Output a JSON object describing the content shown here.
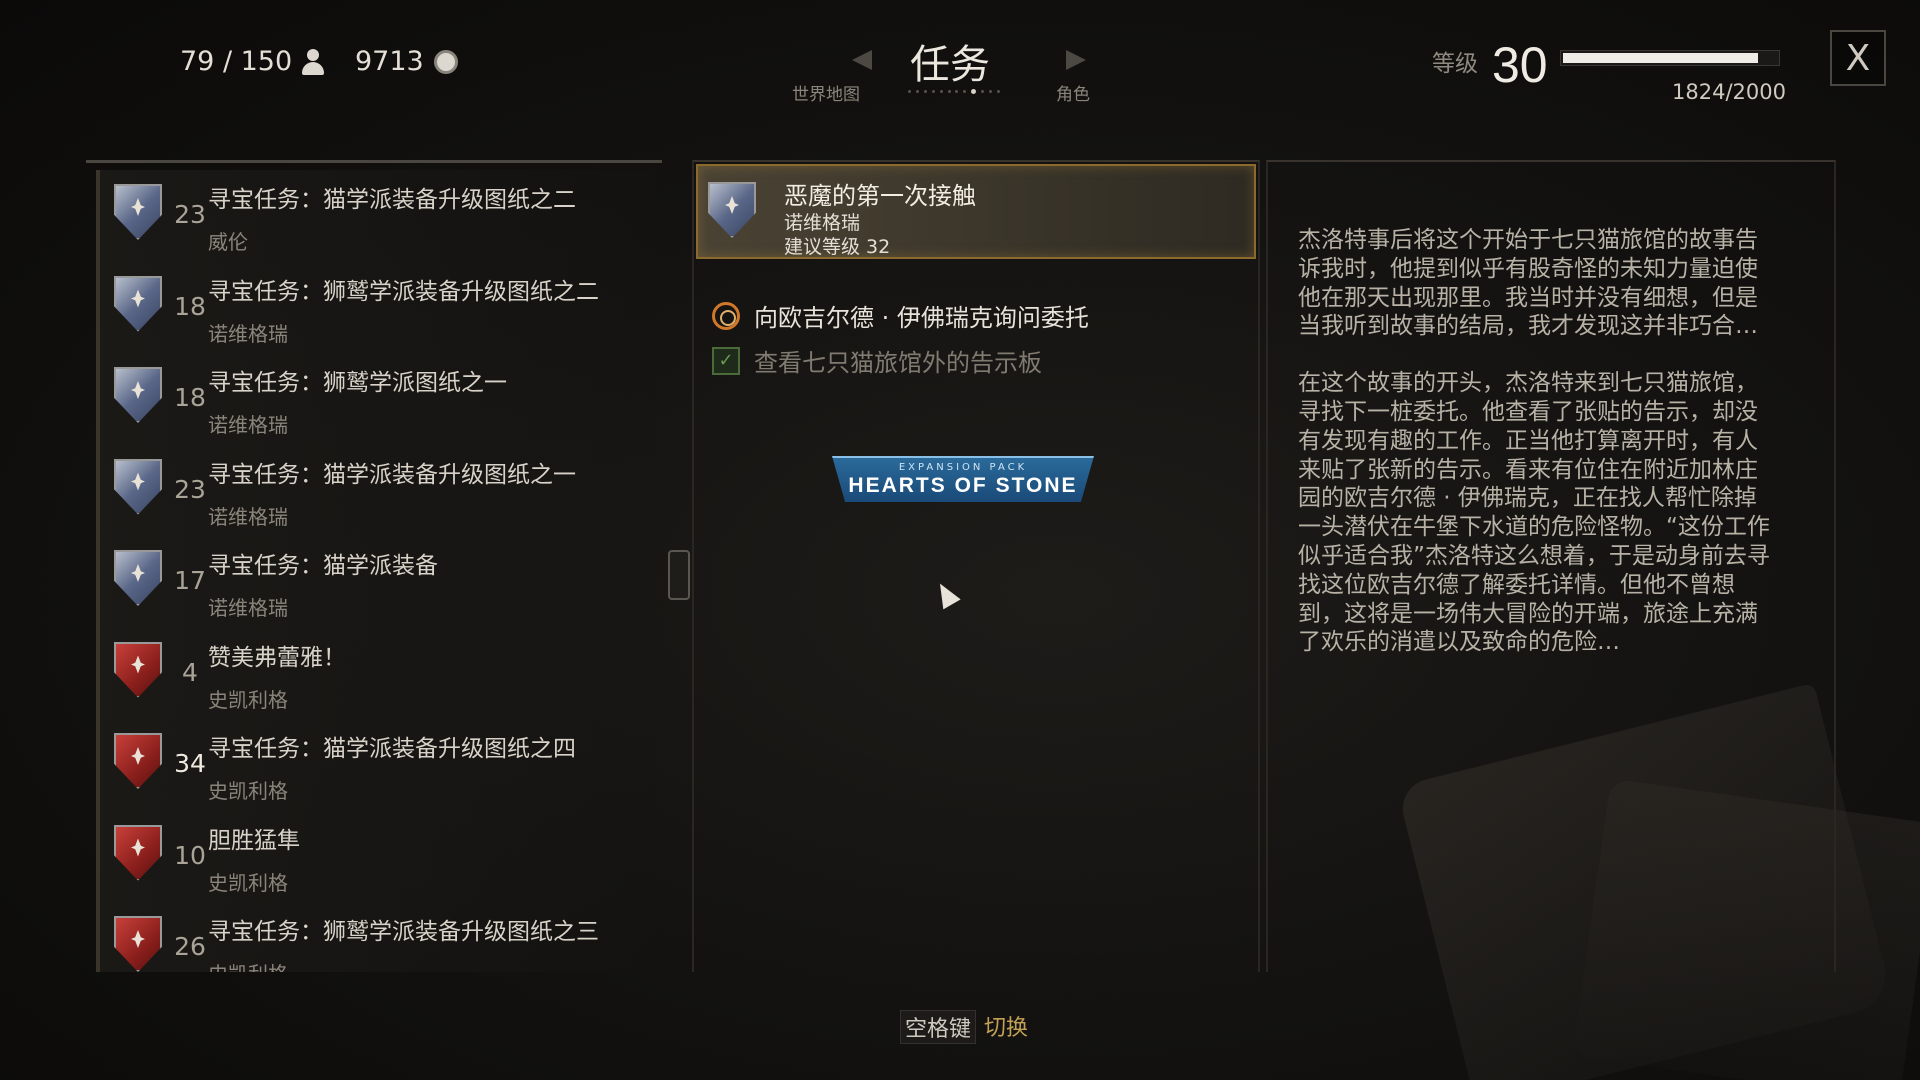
{
  "header": {
    "weight": "79 / 150",
    "money": "9713",
    "title": "任务",
    "nav_left": "世界地图",
    "nav_right": "角色",
    "level_label": "等级",
    "level": "30",
    "xp": "1824/2000",
    "xp_fraction": 0.912,
    "close_label": "X"
  },
  "quest_list": [
    {
      "title": "寻宝任务：猫学派装备升级图纸之二",
      "region": "威伦",
      "level": "23",
      "shield": "blue"
    },
    {
      "title": "寻宝任务：狮鹫学派装备升级图纸之二",
      "region": "诺维格瑞",
      "level": "18",
      "shield": "blue"
    },
    {
      "title": "寻宝任务：狮鹫学派图纸之一",
      "region": "诺维格瑞",
      "level": "18",
      "shield": "blue"
    },
    {
      "title": "寻宝任务：猫学派装备升级图纸之一",
      "region": "诺维格瑞",
      "level": "23",
      "shield": "blue"
    },
    {
      "title": "寻宝任务：猫学派装备",
      "region": "诺维格瑞",
      "level": "17",
      "shield": "blue"
    },
    {
      "title": "赞美弗蕾雅！",
      "region": "史凯利格",
      "level": "4",
      "shield": "red"
    },
    {
      "title": "寻宝任务：猫学派装备升级图纸之四",
      "region": "史凯利格",
      "level": "34",
      "shield": "red"
    },
    {
      "title": "胆胜猛隼",
      "region": "史凯利格",
      "level": "10",
      "shield": "red"
    },
    {
      "title": "寻宝任务：狮鹫学派装备升级图纸之三",
      "region": "史凯利格",
      "level": "26",
      "shield": "red"
    }
  ],
  "selected_quest": {
    "title": "恶魔的第一次接触",
    "region": "诺维格瑞",
    "suggested": "建议等级 32"
  },
  "objectives": [
    {
      "text": "向欧吉尔德 · 伊佛瑞克询问委托",
      "state": "active"
    },
    {
      "text": "查看七只猫旅馆外的告示板",
      "state": "done"
    }
  ],
  "expansion": {
    "small": "EXPANSION PACK",
    "big": "HEARTS OF STONE"
  },
  "description": [
    "杰洛特事后将这个开始于七只猫旅馆的故事告诉我时，他提到似乎有股奇怪的未知力量迫使他在那天出现那里。我当时并没有细想，但是当我听到故事的结局，我才发现这并非巧合…",
    "在这个故事的开头，杰洛特来到七只猫旅馆，寻找下一桩委托。他查看了张贴的告示，却没有发现有趣的工作。正当他打算离开时，有人来贴了张新的告示。看来有位住在附近加林庄园的欧吉尔德 · 伊佛瑞克，正在找人帮忙除掉一头潜伏在牛堡下水道的危险怪物。“这份工作似乎适合我”杰洛特这么想着，于是动身前去寻找这位欧吉尔德了解委托详情。但他不曾想到，这将是一场伟大冒险的开端，旅途上充满了欢乐的消遣以及致命的危险…"
  ],
  "hint": {
    "key": "空格键",
    "action": "切换"
  }
}
